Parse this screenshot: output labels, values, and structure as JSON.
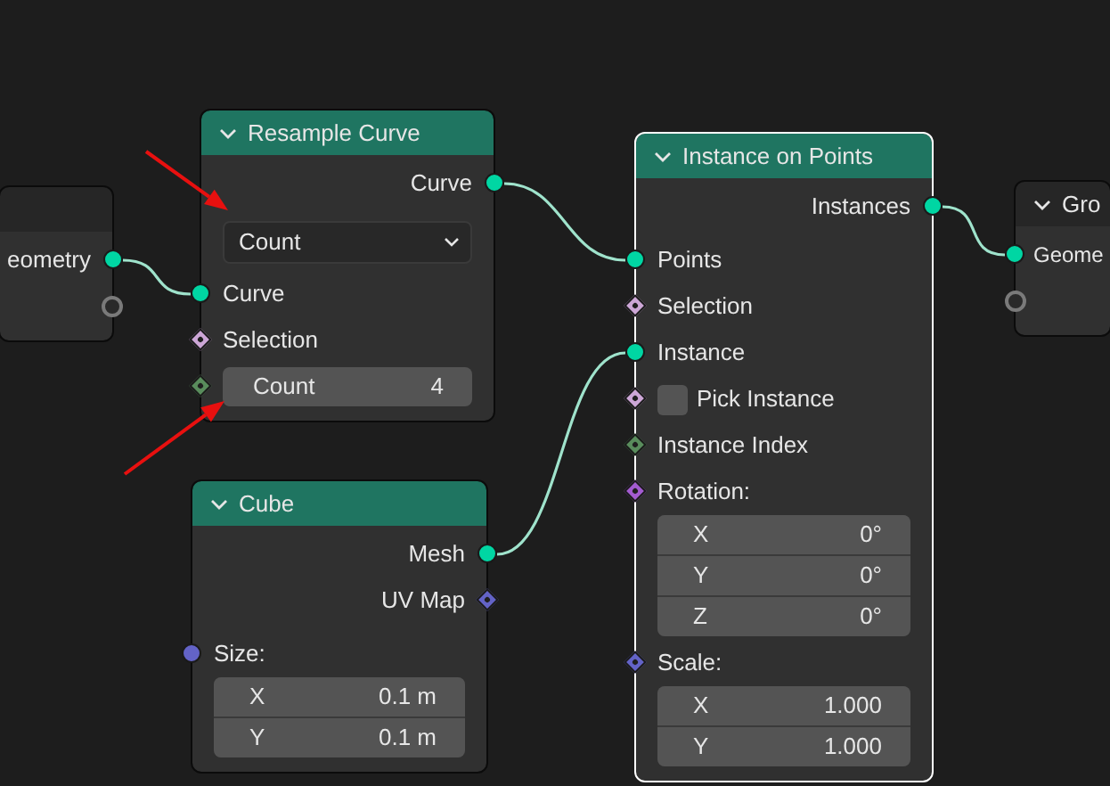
{
  "nodes": [
    {
      "color": "#262626",
      "selected": false,
      "rows": [
        {
          "kind": "output",
          "label": "eometry",
          "socket": {
            "kind": "circle",
            "color": "#00d6a3"
          }
        },
        {
          "kind": "output",
          "socket": {
            "kind": "hollow",
            "color": "#7a7a7a"
          }
        }
      ]
    },
    {
      "title": "Resample Curve",
      "color": "#1f7561",
      "selected": false,
      "rows": [
        {
          "kind": "output",
          "label": "Curve",
          "socket": {
            "kind": "circle",
            "color": "#00d6a3"
          }
        },
        {
          "kind": "dropdown",
          "value": "Count"
        },
        {
          "kind": "input",
          "label": "Curve",
          "socket": {
            "kind": "circle",
            "color": "#00d6a3"
          }
        },
        {
          "kind": "input",
          "label": "Selection",
          "socket": {
            "kind": "diamond",
            "color": "#cca6d6"
          }
        },
        {
          "kind": "field",
          "label": "Count",
          "value": "4",
          "socket": {
            "kind": "diamond",
            "color": "#598c5c"
          }
        }
      ]
    },
    {
      "title": "Cube",
      "color": "#1f7561",
      "selected": false,
      "rows": [
        {
          "kind": "output",
          "label": "Mesh",
          "socket": {
            "kind": "circle",
            "color": "#00d6a3"
          }
        },
        {
          "kind": "output",
          "label": "UV Map",
          "socket": {
            "kind": "diamond",
            "color": "#6363c7"
          }
        },
        {
          "kind": "section",
          "label": "Size:",
          "socket": {
            "kind": "circle",
            "color": "#6363c7"
          },
          "fields": [
            {
              "label": "X",
              "value": "0.1 m"
            },
            {
              "label": "Y",
              "value": "0.1 m"
            }
          ]
        }
      ]
    },
    {
      "title": "Instance on Points",
      "color": "#1f7561",
      "selected": true,
      "rows": [
        {
          "kind": "output",
          "label": "Instances",
          "socket": {
            "kind": "circle",
            "color": "#00d6a3"
          }
        },
        {
          "kind": "input",
          "label": "Points",
          "socket": {
            "kind": "circle",
            "color": "#00d6a3"
          }
        },
        {
          "kind": "input",
          "label": "Selection",
          "socket": {
            "kind": "diamond",
            "color": "#cca6d6"
          }
        },
        {
          "kind": "input",
          "label": "Instance",
          "socket": {
            "kind": "circle",
            "color": "#00d6a3"
          }
        },
        {
          "kind": "checkbox",
          "label": "Pick Instance",
          "checked": false,
          "socket": {
            "kind": "diamond",
            "color": "#cca6d6"
          }
        },
        {
          "kind": "input",
          "label": "Instance Index",
          "socket": {
            "kind": "diamond",
            "color": "#598c5c"
          }
        },
        {
          "kind": "section",
          "label": "Rotation:",
          "socket": {
            "kind": "diamond",
            "color": "#a35bd0"
          },
          "fields": [
            {
              "label": "X",
              "value": "0°"
            },
            {
              "label": "Y",
              "value": "0°"
            },
            {
              "label": "Z",
              "value": "0°"
            }
          ]
        },
        {
          "kind": "section",
          "label": "Scale:",
          "socket": {
            "kind": "diamond",
            "color": "#6363c7"
          },
          "fields": [
            {
              "label": "X",
              "value": "1.000"
            },
            {
              "label": "Y",
              "value": "1.000"
            }
          ]
        }
      ]
    },
    {
      "title": "Gro",
      "color": "#262626",
      "selected": false,
      "rows": [
        {
          "kind": "input",
          "label": "Geome",
          "socket": {
            "kind": "circle",
            "color": "#00d6a3"
          }
        },
        {
          "kind": "input",
          "socket": {
            "kind": "hollow",
            "color": "#7a7a7a"
          }
        }
      ]
    }
  ]
}
